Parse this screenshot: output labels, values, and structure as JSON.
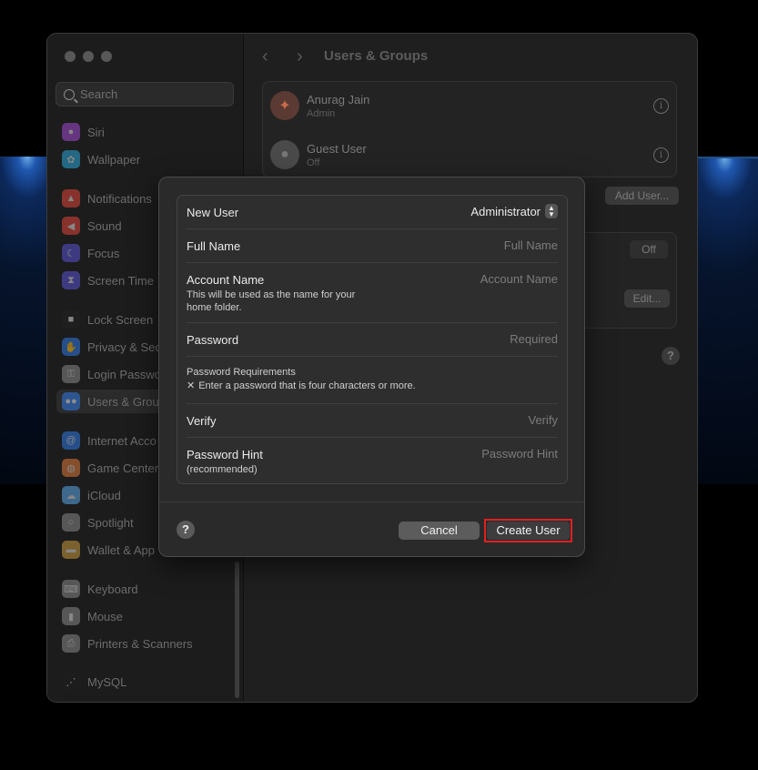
{
  "window": {
    "title": "Users & Groups"
  },
  "search": {
    "placeholder": "Search"
  },
  "sidebar": {
    "items": [
      {
        "label": "Siri",
        "icon": "siri-icon",
        "color": "#a24bd0"
      },
      {
        "label": "Wallpaper",
        "icon": "wallpaper-icon",
        "color": "#2aa6d9"
      },
      {
        "label": "Notifications",
        "icon": "bell-icon",
        "color": "#e0443a"
      },
      {
        "label": "Sound",
        "icon": "speaker-icon",
        "color": "#e0443a"
      },
      {
        "label": "Focus",
        "icon": "moon-icon",
        "color": "#5b54d6"
      },
      {
        "label": "Screen Time",
        "icon": "hourglass-icon",
        "color": "#5b54d6"
      },
      {
        "label": "Lock Screen",
        "icon": "lock-icon",
        "color": "#222222"
      },
      {
        "label": "Privacy & Sec",
        "icon": "hand-icon",
        "color": "#2f7ae5"
      },
      {
        "label": "Login Passwo",
        "icon": "key-icon",
        "color": "#888888"
      },
      {
        "label": "Users & Grou",
        "icon": "users-icon",
        "color": "#2f7ae5"
      },
      {
        "label": "Internet Acco",
        "icon": "at-icon",
        "color": "#2f7ae5"
      },
      {
        "label": "Game Center",
        "icon": "game-center-icon",
        "color": "#dd7a3a"
      },
      {
        "label": "iCloud",
        "icon": "cloud-icon",
        "color": "#5aa8e8"
      },
      {
        "label": "Spotlight",
        "icon": "magnifier-icon",
        "color": "#888888"
      },
      {
        "label": "Wallet & App",
        "icon": "wallet-icon",
        "color": "#c79a3c"
      },
      {
        "label": "Keyboard",
        "icon": "keyboard-icon",
        "color": "#888888"
      },
      {
        "label": "Mouse",
        "icon": "mouse-icon",
        "color": "#888888"
      },
      {
        "label": "Printers & Scanners",
        "icon": "printer-icon",
        "color": "#888888"
      },
      {
        "label": "MySQL",
        "icon": "mysql-icon",
        "color": "#1f1f1f"
      }
    ]
  },
  "users": [
    {
      "name": "Anurag Jain",
      "role": "Admin"
    },
    {
      "name": "Guest User",
      "role": "Off"
    }
  ],
  "background_buttons": {
    "add_user": "Add User...",
    "off_label": "Off",
    "edit": "Edit...",
    "help": "?"
  },
  "dialog": {
    "rows": {
      "new_user": {
        "label": "New User",
        "value": "Administrator"
      },
      "full_name": {
        "label": "Full Name",
        "placeholder": "Full Name"
      },
      "account_name": {
        "label": "Account Name",
        "placeholder": "Account Name",
        "sub1": "This will be used as the name for your",
        "sub2": "home folder."
      },
      "password": {
        "label": "Password",
        "placeholder": "Required"
      },
      "requirements": {
        "title": "Password Requirements",
        "item": "Enter a password that is four characters or more."
      },
      "verify": {
        "label": "Verify",
        "placeholder": "Verify"
      },
      "hint": {
        "label": "Password Hint",
        "sub": "(recommended)",
        "placeholder": "Password Hint"
      }
    },
    "help": "?",
    "cancel": "Cancel",
    "create": "Create User",
    "highlight_color": "#e02020"
  }
}
